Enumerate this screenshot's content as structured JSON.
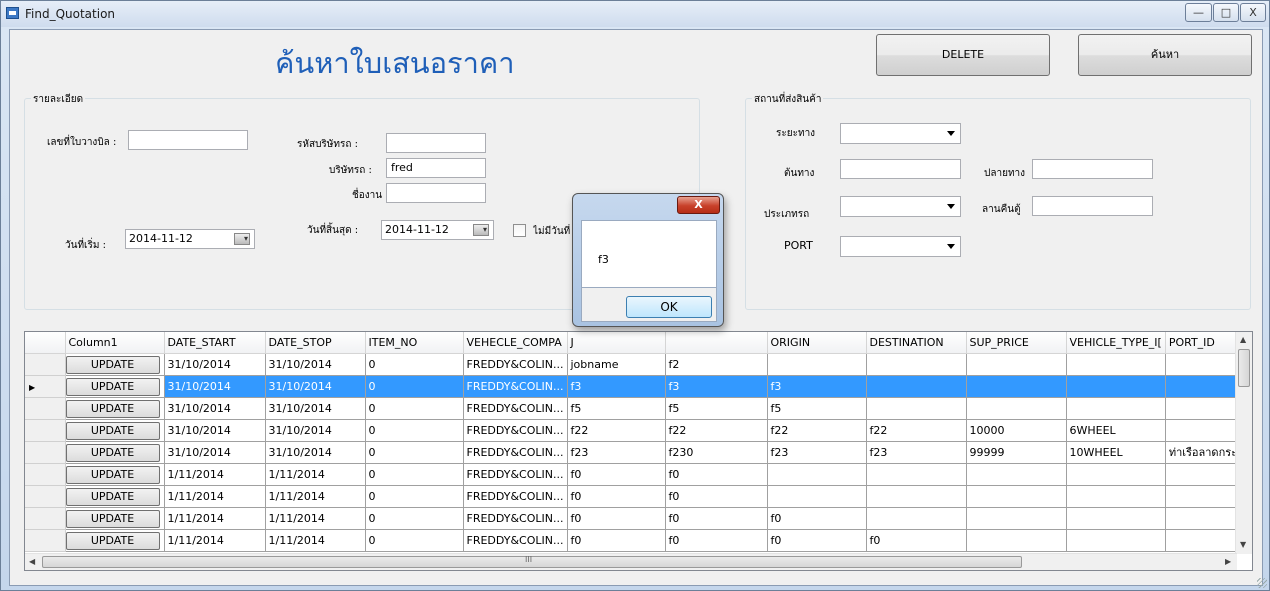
{
  "window": {
    "title": "Find_Quotation",
    "minimize_label": "—",
    "maximize_label": "□",
    "close_label": "X"
  },
  "heading": "ค้นหาใบเสนอราคา",
  "buttons": {
    "delete_label": "DELETE",
    "search_label": "ค้นหา"
  },
  "details": {
    "legend": "รายละเอียด",
    "bill_no_label": "เลขที่ใบวางบิล :",
    "bill_no_value": "",
    "company_code_label": "รหัสบริษัทรถ :",
    "company_code_value": "",
    "company_label": "บริษัทรถ :",
    "company_value": "fred",
    "job_name_label": "ชื่องาน :",
    "job_name_value": "",
    "start_date_label": "วันที่เริ่ม :",
    "start_date_value": "2014-11-12",
    "end_date_label": "วันที่สิ้นสุด :",
    "end_date_value": "2014-11-12",
    "no_date_label": "ไม่มีวันที่"
  },
  "delivery": {
    "legend": "สถานที่ส่งสินค้า",
    "distance_label": "ระยะทาง",
    "origin_label": "ต้นทาง",
    "origin_value": "",
    "destination_label": "ปลายทาง",
    "destination_value": "",
    "type_label": "ประเภทรถ",
    "return_label": "ลานคืนตู้",
    "return_value": "",
    "port_label": "PORT"
  },
  "grid": {
    "columns": [
      "Column1",
      "DATE_START",
      "DATE_STOP",
      "ITEM_NO",
      "VEHECLE_COMPA",
      "J",
      "",
      "ORIGIN",
      "DESTINATION",
      "SUP_PRICE",
      "VEHICLE_TYPE_I[",
      "PORT_ID"
    ],
    "update_label": "UPDATE",
    "rows": [
      {
        "c": [
          "31/10/2014",
          "31/10/2014",
          "0",
          "FREDDY&COLIN...",
          "jobname",
          "f2",
          "",
          "",
          "",
          "",
          ""
        ]
      },
      {
        "c": [
          "31/10/2014",
          "31/10/2014",
          "0",
          "FREDDY&COLIN...",
          "f3",
          "f3",
          "f3",
          "",
          "",
          "",
          ""
        ]
      },
      {
        "c": [
          "31/10/2014",
          "31/10/2014",
          "0",
          "FREDDY&COLIN...",
          "f5",
          "f5",
          "f5",
          "",
          "",
          "",
          ""
        ]
      },
      {
        "c": [
          "31/10/2014",
          "31/10/2014",
          "0",
          "FREDDY&COLIN...",
          "f22",
          "f22",
          "f22",
          "f22",
          "10000",
          "6WHEEL",
          ""
        ]
      },
      {
        "c": [
          "31/10/2014",
          "31/10/2014",
          "0",
          "FREDDY&COLIN...",
          "f23",
          "f230",
          "f23",
          "f23",
          "99999",
          "10WHEEL",
          "ท่าเรือลาดกระ"
        ]
      },
      {
        "c": [
          "1/11/2014",
          "1/11/2014",
          "0",
          "FREDDY&COLIN...",
          "f0",
          "f0",
          "",
          "",
          "",
          "",
          ""
        ]
      },
      {
        "c": [
          "1/11/2014",
          "1/11/2014",
          "0",
          "FREDDY&COLIN...",
          "f0",
          "f0",
          "",
          "",
          "",
          "",
          ""
        ]
      },
      {
        "c": [
          "1/11/2014",
          "1/11/2014",
          "0",
          "FREDDY&COLIN...",
          "f0",
          "f0",
          "f0",
          "",
          "",
          "",
          ""
        ]
      },
      {
        "c": [
          "1/11/2014",
          "1/11/2014",
          "0",
          "FREDDY&COLIN...",
          "f0",
          "f0",
          "f0",
          "f0",
          "",
          "",
          ""
        ]
      }
    ],
    "selected_row": 1,
    "scroll_mark": "III"
  },
  "dialog": {
    "message": "f3",
    "ok_label": "OK",
    "close_label": "X"
  },
  "colors": {
    "heading": "#1f5fb8",
    "selection": "#3399ff"
  }
}
